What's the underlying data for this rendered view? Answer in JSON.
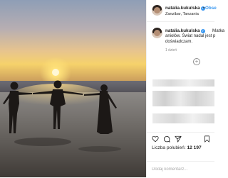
{
  "post": {
    "username": "natalia.kukulska",
    "follow_label": "Obse",
    "location": "Zanzibar, Tanzania",
    "caption_head": "Matka",
    "caption_lines": [
      "aniołów. Świat nadal jest p",
      "doświadczam."
    ],
    "time_ago": "1 dzień",
    "likes_label": "Liczba polubień:",
    "likes_count": "12 197",
    "comment_placeholder": "Dodaj komentarz..."
  },
  "icons": {
    "more": "plus-circle-icon",
    "verified": "verified-badge-icon",
    "like": "heart-icon",
    "comment": "comment-bubble-icon",
    "share": "share-arrow-icon",
    "save": "bookmark-icon"
  },
  "colors": {
    "link_blue": "#3897f0",
    "text": "#262626",
    "muted": "#8e8e8e"
  }
}
